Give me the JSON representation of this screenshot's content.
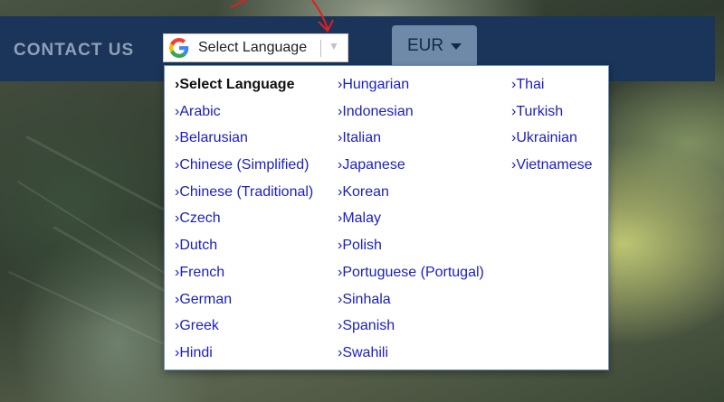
{
  "nav": {
    "contact_label": "CONTACT US"
  },
  "language_select": {
    "label": "Select Language",
    "caret": "▼"
  },
  "currency": {
    "label": "EUR"
  },
  "dropdown": {
    "columns": [
      [
        "Select Language",
        "Arabic",
        "Belarusian",
        "Chinese (Simplified)",
        "Chinese (Traditional)",
        "Czech",
        "Dutch",
        "French",
        "German",
        "Greek",
        "Hindi"
      ],
      [
        "Hungarian",
        "Indonesian",
        "Italian",
        "Japanese",
        "Korean",
        "Malay",
        "Polish",
        "Portuguese (Portugal)",
        "Sinhala",
        "Spanish",
        "Swahili"
      ],
      [
        "Thai",
        "Turkish",
        "Ukrainian",
        "Vietnamese"
      ]
    ],
    "selected": "Select Language"
  },
  "colors": {
    "navbar": "#1a3559",
    "link": "#1a1ec2",
    "currency_bg": "#6f8aa9",
    "annotation_arrow": "#e0201c"
  }
}
